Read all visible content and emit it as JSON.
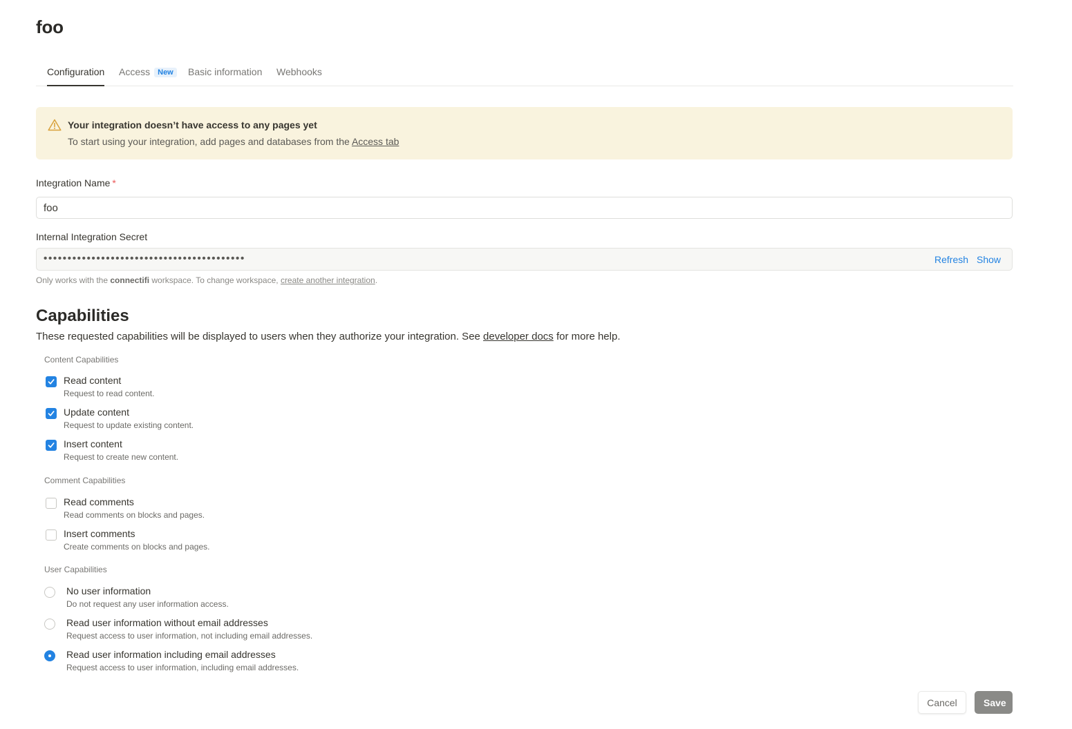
{
  "page": {
    "title": "foo"
  },
  "tabs": [
    {
      "label": "Configuration",
      "active": true
    },
    {
      "label": "Access",
      "badge": "New",
      "active": false
    },
    {
      "label": "Basic information",
      "active": false
    },
    {
      "label": "Webhooks",
      "active": false
    }
  ],
  "banner": {
    "icon": "warning-icon",
    "title": "Your integration doesn’t have access to any pages yet",
    "body_prefix": "To start using your integration, add pages and databases from the ",
    "body_link": "Access tab",
    "bg_color": "#f9f3de",
    "icon_color": "#d9a13b"
  },
  "integration_name": {
    "label": "Integration Name",
    "required_mark": "*",
    "value": "foo"
  },
  "secret": {
    "label": "Internal Integration Secret",
    "masked_value": "••••••••••••••••••••••••••••••••••••••••••",
    "refresh_label": "Refresh",
    "show_label": "Show"
  },
  "workspace_note": {
    "prefix": "Only works with the ",
    "workspace": "connectifi",
    "middle": " workspace. To change workspace, ",
    "link": "create another integration",
    "suffix": "."
  },
  "capabilities": {
    "title": "Capabilities",
    "desc_prefix": "These requested capabilities will be displayed to users when they authorize your integration. See ",
    "desc_link": "developer docs",
    "desc_suffix": " for more help.",
    "content": {
      "label": "Content Capabilities",
      "options": [
        {
          "title": "Read content",
          "desc": "Request to read content.",
          "checked": true
        },
        {
          "title": "Update content",
          "desc": "Request to update existing content.",
          "checked": true
        },
        {
          "title": "Insert content",
          "desc": "Request to create new content.",
          "checked": true
        }
      ]
    },
    "comment": {
      "label": "Comment Capabilities",
      "options": [
        {
          "title": "Read comments",
          "desc": "Read comments on blocks and pages.",
          "checked": false
        },
        {
          "title": "Insert comments",
          "desc": "Create comments on blocks and pages.",
          "checked": false
        }
      ]
    },
    "user": {
      "label": "User Capabilities",
      "options": [
        {
          "title": "No user information",
          "desc": "Do not request any user information access.",
          "selected": false
        },
        {
          "title": "Read user information without email addresses",
          "desc": "Request access to user information, not including email addresses.",
          "selected": false
        },
        {
          "title": "Read user information including email addresses",
          "desc": "Request access to user information, including email addresses.",
          "selected": true
        }
      ]
    }
  },
  "footer": {
    "cancel_label": "Cancel",
    "save_label": "Save"
  },
  "colors": {
    "accent": "#2383e2",
    "save_disabled": "#8a8a87"
  }
}
